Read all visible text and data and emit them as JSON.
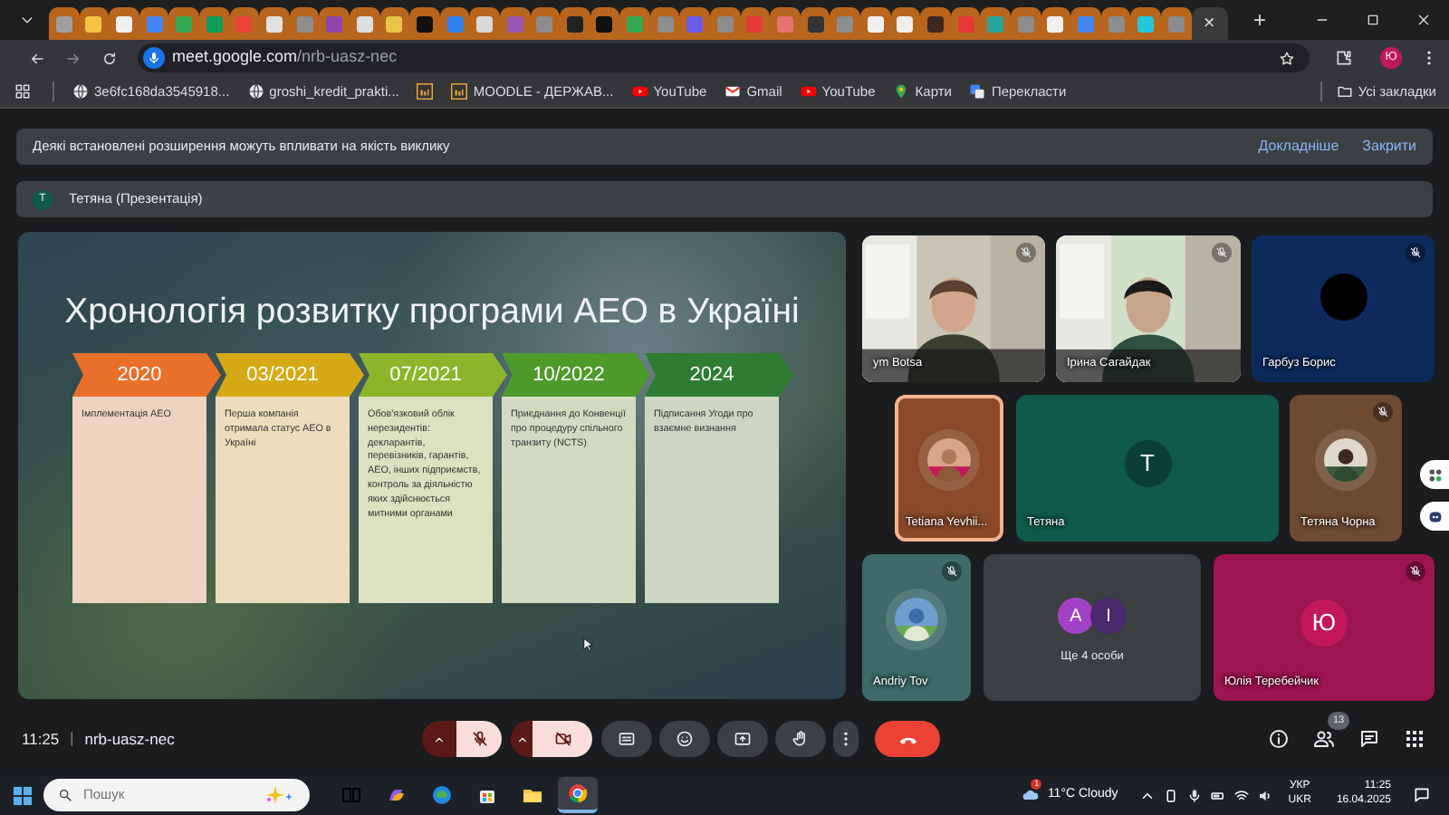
{
  "browser": {
    "tabs": [
      {
        "color": "#9e9e9e",
        "selected": false
      },
      {
        "color": "#f5c542",
        "selected": false
      },
      {
        "color": "#eeeeee",
        "selected": false
      },
      {
        "color": "#4285f4",
        "selected": false
      },
      {
        "color": "#34a853",
        "selected": false
      },
      {
        "color": "#0f9d58",
        "selected": false
      },
      {
        "color": "#ea4335",
        "selected": false
      },
      {
        "color": "#e0e0e0",
        "selected": false
      },
      {
        "color": "#8d8d8d",
        "selected": false
      },
      {
        "color": "#8e44ad",
        "selected": false
      },
      {
        "color": "#dddddd",
        "selected": false
      },
      {
        "color": "#e8c547",
        "selected": false
      },
      {
        "color": "#111111",
        "selected": false
      },
      {
        "color": "#2f80ed",
        "selected": false
      },
      {
        "color": "#d9d9d9",
        "selected": false
      },
      {
        "color": "#9b59b6",
        "selected": false
      },
      {
        "color": "#8d8d8d",
        "selected": false
      },
      {
        "color": "#222222",
        "selected": false
      },
      {
        "color": "#111111",
        "selected": false
      },
      {
        "color": "#34a853",
        "selected": false
      },
      {
        "color": "#8d8d8d",
        "selected": false
      },
      {
        "color": "#6c5ce7",
        "selected": false
      },
      {
        "color": "#8d8d8d",
        "selected": false
      },
      {
        "color": "#e53935",
        "selected": false
      },
      {
        "color": "#e57373",
        "selected": false
      },
      {
        "color": "#333333",
        "selected": false
      },
      {
        "color": "#8d8d8d",
        "selected": false
      },
      {
        "color": "#f0f0f0",
        "selected": false
      },
      {
        "color": "#eeeeee",
        "selected": false
      },
      {
        "color": "#3e2723",
        "selected": false
      },
      {
        "color": "#e53935",
        "selected": false
      },
      {
        "color": "#26a69a",
        "selected": false
      },
      {
        "color": "#8d8d8d",
        "selected": false
      },
      {
        "color": "#f0f0f0",
        "selected": false
      },
      {
        "color": "#4285f4",
        "selected": false
      },
      {
        "color": "#8d8d8d",
        "selected": false
      },
      {
        "color": "#26c6da",
        "selected": false
      },
      {
        "color": "#8d8d8d",
        "selected": false
      },
      {
        "selected": true
      }
    ],
    "close_tab": "×",
    "new_tab": "+",
    "url_domain": "meet.google.com",
    "url_path": "/nrb-uasz-nec",
    "profile": "Ю",
    "bookmarks": [
      {
        "kind": "globe",
        "label": "3e6fc168da3545918..."
      },
      {
        "kind": "globe",
        "label": "groshi_kredit_prakti..."
      },
      {
        "kind": "moodle"
      },
      {
        "kind": "moodle",
        "label": "MOODLE - ДЕРЖАВ..."
      },
      {
        "kind": "youtube",
        "label": "YouTube"
      },
      {
        "kind": "gmail",
        "label": "Gmail"
      },
      {
        "kind": "youtube",
        "label": "YouTube"
      },
      {
        "kind": "maps",
        "label": "Карти"
      },
      {
        "kind": "translate",
        "label": "Перекласти"
      }
    ],
    "all_bookmarks": "Усі закладки"
  },
  "meet": {
    "banner": {
      "text": "Деякі встановлені розширення можуть впливати на якість виклику",
      "links": [
        "Докладніше",
        "Закрити"
      ]
    },
    "presenter": {
      "avatar": "T",
      "name": "Тетяна (Презентація)"
    },
    "slide": {
      "title": "Хронологія розвитку програми АЕО в Україні",
      "timeline": [
        {
          "year": "2020",
          "text": "Імплементація АЕО",
          "color": "#e8702a"
        },
        {
          "year": "03/2021",
          "text": "Перша компанія отримала статус АЕО в Україні",
          "color": "#d6a916"
        },
        {
          "year": "07/2021",
          "text": "Обов'язковий облік нерезидентів: декларантів, перевізників, гарантів, АЕО, інших підприємств, контроль за діяльністю яких здійснюється митними органами",
          "color": "#8cb52c"
        },
        {
          "year": "10/2022",
          "text": "Приєднання до Конвенції про процедуру спільного транзиту (NCTS)",
          "color": "#4e9a2a"
        },
        {
          "year": "2024",
          "text": "Підписання Угоди про взаємне визнання",
          "color": "#2e7d32"
        }
      ]
    },
    "tile_rows": [
      {
        "tiles": [
          {
            "kind": "video",
            "name": "ym Botsa",
            "muted": true,
            "speaking": false,
            "color": "#c9c4b5"
          },
          {
            "kind": "video",
            "name": "Ірина Сагайдак",
            "muted": true,
            "speaking": false,
            "color": "#cfe0c8"
          },
          {
            "kind": "blank-avatar",
            "name": "Гарбуз Борис",
            "muted": true,
            "speaking": false,
            "color": "#0d2a5c"
          }
        ]
      },
      {
        "tiles": [
          {
            "kind": "avatar",
            "name": "Tetiana Yevhii...",
            "muted": false,
            "speaking": true,
            "color": "#8a4a2a"
          },
          {
            "kind": "letter",
            "letter": "T",
            "name": "Тетяна",
            "muted": false,
            "speaking": false,
            "color": "#0f5a4a"
          },
          {
            "kind": "avatar",
            "name": "Тетяна Чорна",
            "muted": true,
            "speaking": false,
            "color": "#6e4a33"
          }
        ]
      },
      {
        "tiles": [
          {
            "kind": "avatar",
            "name": "Andriy Tov",
            "muted": true,
            "speaking": false,
            "color": "#3e6a6a"
          },
          {
            "kind": "group",
            "label": "Ще 4 особи",
            "avatars": [
              {
                "letter": "A",
                "color": "#a142c4"
              },
              {
                "letter": "I",
                "color": "#4a2a6e"
              }
            ],
            "muted": false,
            "speaking": false,
            "color": "#3c4043"
          },
          {
            "kind": "letter",
            "letter": "Ю",
            "name": "Юлія Теребейчик",
            "muted": true,
            "speaking": false,
            "color": "#9c1450"
          }
        ]
      }
    ],
    "bottom": {
      "time": "11:25",
      "separator": "|",
      "code": "nrb-uasz-nec",
      "mic_on": false,
      "camera_on": false,
      "people_count": "13"
    }
  },
  "taskbar": {
    "search_placeholder": "Пошук",
    "apps": [
      {
        "kind": "taskview",
        "selected": false
      },
      {
        "kind": "copilot",
        "selected": false
      },
      {
        "kind": "edge",
        "selected": false
      },
      {
        "kind": "store",
        "selected": false
      },
      {
        "kind": "explorer",
        "selected": false
      },
      {
        "kind": "chrome",
        "selected": true
      }
    ],
    "weather": "11°C Cloudy",
    "weather_badge": "1",
    "lang": "УКР",
    "lang_latin": "UKR",
    "time": "11:25",
    "date": "16.04.2025"
  }
}
